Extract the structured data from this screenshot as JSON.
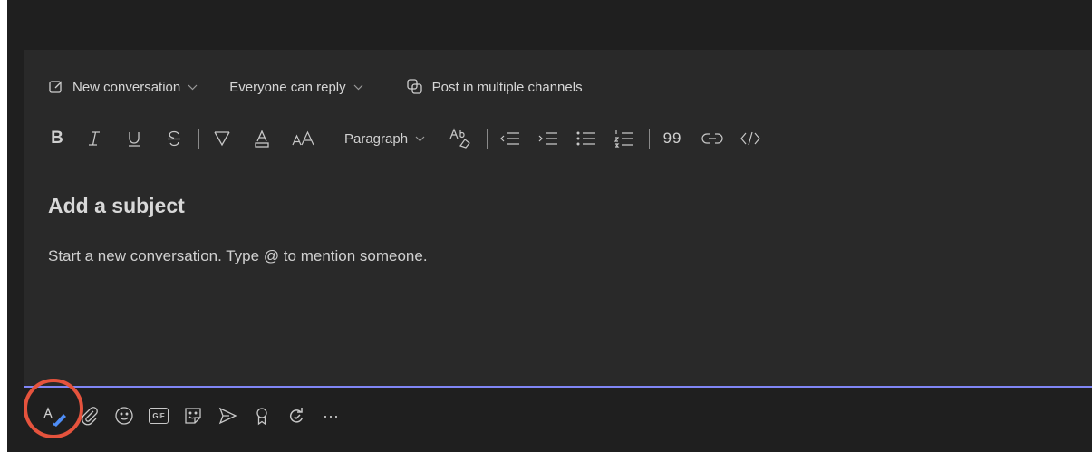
{
  "compose": {
    "toolbar": {
      "new_conversation_label": "New conversation",
      "reply_setting_label": "Everyone can reply",
      "post_multiple_label": "Post in multiple channels"
    },
    "format": {
      "bold_label": "B",
      "paragraph_label": "Paragraph",
      "quote_label": "99"
    },
    "subject_placeholder": "Add a subject",
    "body_placeholder": "Start a new conversation. Type @ to mention someone.",
    "actions": {
      "gif_label": "GIF",
      "more_label": "···"
    }
  },
  "colors": {
    "background": "#1f1f1f",
    "compose_background": "#292929",
    "accent": "#7f85f5",
    "format_icon_accent": "#4f8ef7",
    "highlight": "#e5533d"
  }
}
